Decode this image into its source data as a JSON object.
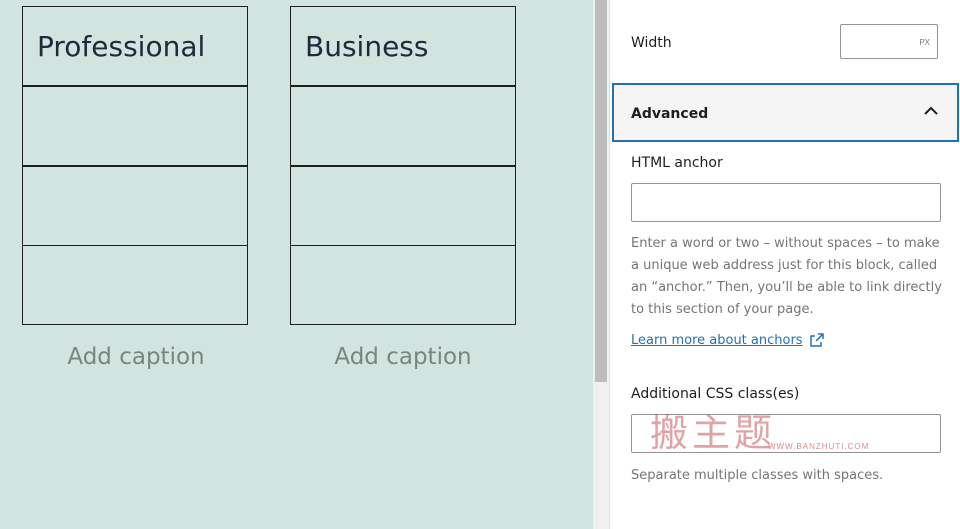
{
  "canvas": {
    "tables": [
      {
        "header": "Professional",
        "caption": "Add caption"
      },
      {
        "header": "Business",
        "caption": "Add caption"
      }
    ]
  },
  "sidebar": {
    "width": {
      "label": "Width",
      "value": "",
      "unit": "PX"
    },
    "advanced": {
      "title": "Advanced",
      "html_anchor": {
        "label": "HTML anchor",
        "value": "",
        "help": "Enter a word or two – without spaces – to make a unique web address just for this block, called an “anchor.” Then, you’ll be able to link directly to this section of your page.",
        "link": "Learn more about anchors"
      },
      "css_classes": {
        "label": "Additional CSS class(es)",
        "value": "",
        "help": "Separate multiple classes with spaces."
      }
    },
    "watermark": {
      "text": "搬主题",
      "url": "WWW.BANZHUTI.COM"
    }
  },
  "colors": {
    "canvas_bg": "#d2e4df",
    "focus": "#2271b1",
    "link": "#2271b1"
  }
}
